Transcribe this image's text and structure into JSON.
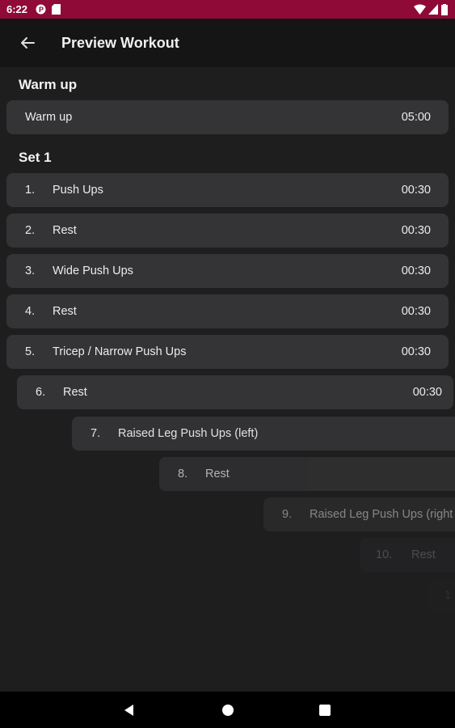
{
  "status": {
    "time": "6:22"
  },
  "header": {
    "title": "Preview Workout"
  },
  "warmup": {
    "title": "Warm up",
    "row": {
      "name": "Warm up",
      "duration": "05:00"
    }
  },
  "set1": {
    "title": "Set 1",
    "items": [
      {
        "num": "1.",
        "name": "Push Ups",
        "duration": "00:30"
      },
      {
        "num": "2.",
        "name": "Rest",
        "duration": "00:30"
      },
      {
        "num": "3.",
        "name": "Wide Push Ups",
        "duration": "00:30"
      },
      {
        "num": "4.",
        "name": "Rest",
        "duration": "00:30"
      },
      {
        "num": "5.",
        "name": "Tricep / Narrow Push Ups",
        "duration": "00:30"
      },
      {
        "num": "6.",
        "name": "Rest",
        "duration": "00:30"
      },
      {
        "num": "7.",
        "name": "Raised Leg Push Ups (left)",
        "duration": ""
      },
      {
        "num": "8.",
        "name": "Rest",
        "duration": ""
      },
      {
        "num": "9.",
        "name": "Raised Leg Push Ups (right",
        "duration": ""
      },
      {
        "num": "10.",
        "name": "Rest",
        "duration": ""
      },
      {
        "num": "1",
        "name": "",
        "duration": ""
      }
    ]
  }
}
